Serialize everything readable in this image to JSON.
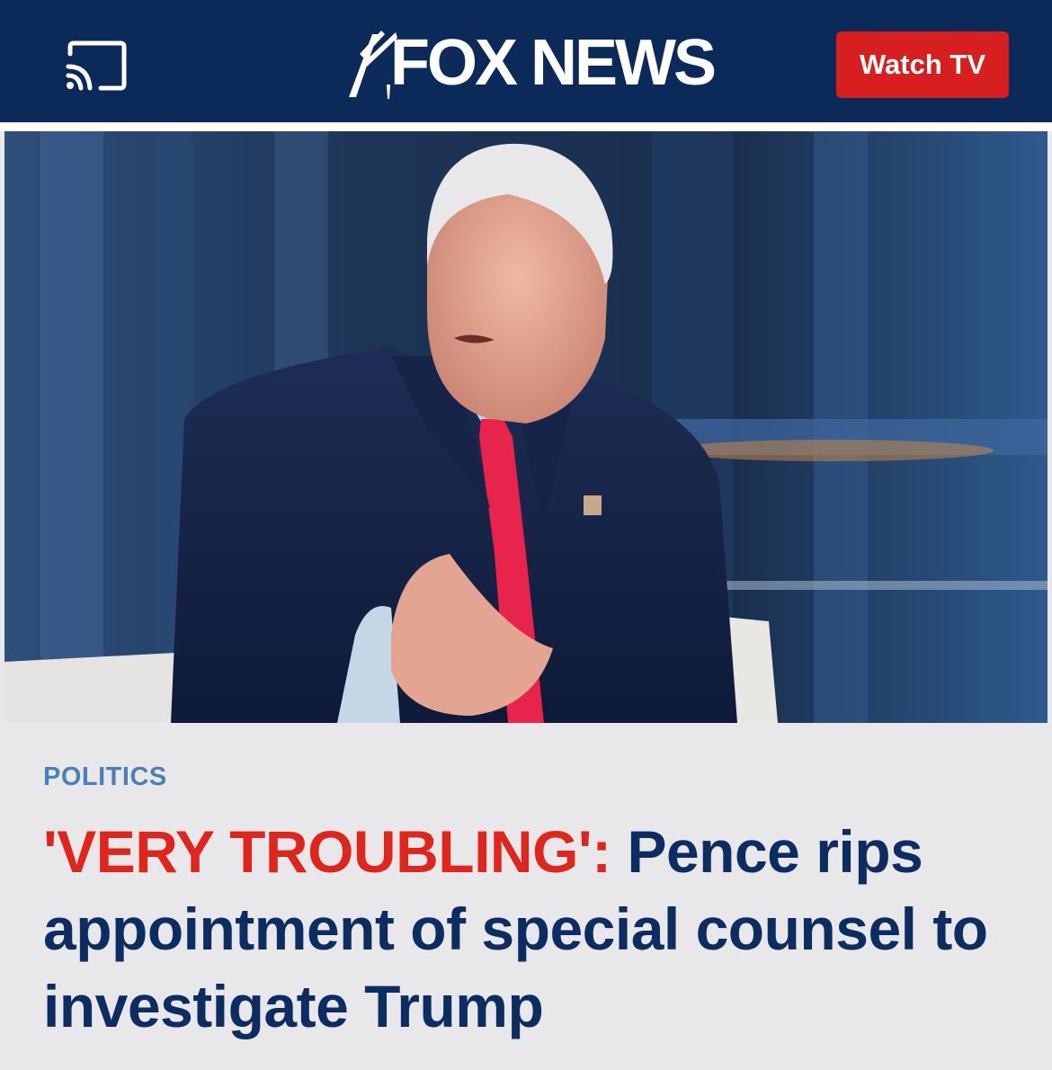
{
  "header": {
    "brand_name": "FOX NEWS",
    "watch_tv_label": "Watch TV",
    "background_color": "#0b2a5a",
    "watch_button_color": "#d81f1f",
    "cast_icon": "cast-icon"
  },
  "hero_image": {
    "description": "photo"
  },
  "article": {
    "category": "POLITICS",
    "kicker": "'VERY TROUBLING':",
    "headline": "Pence rips appointment of special counsel to investigate Trump",
    "kicker_color": "#e0261c",
    "headline_color": "#0d2d62",
    "category_color": "#4b7fb5"
  }
}
